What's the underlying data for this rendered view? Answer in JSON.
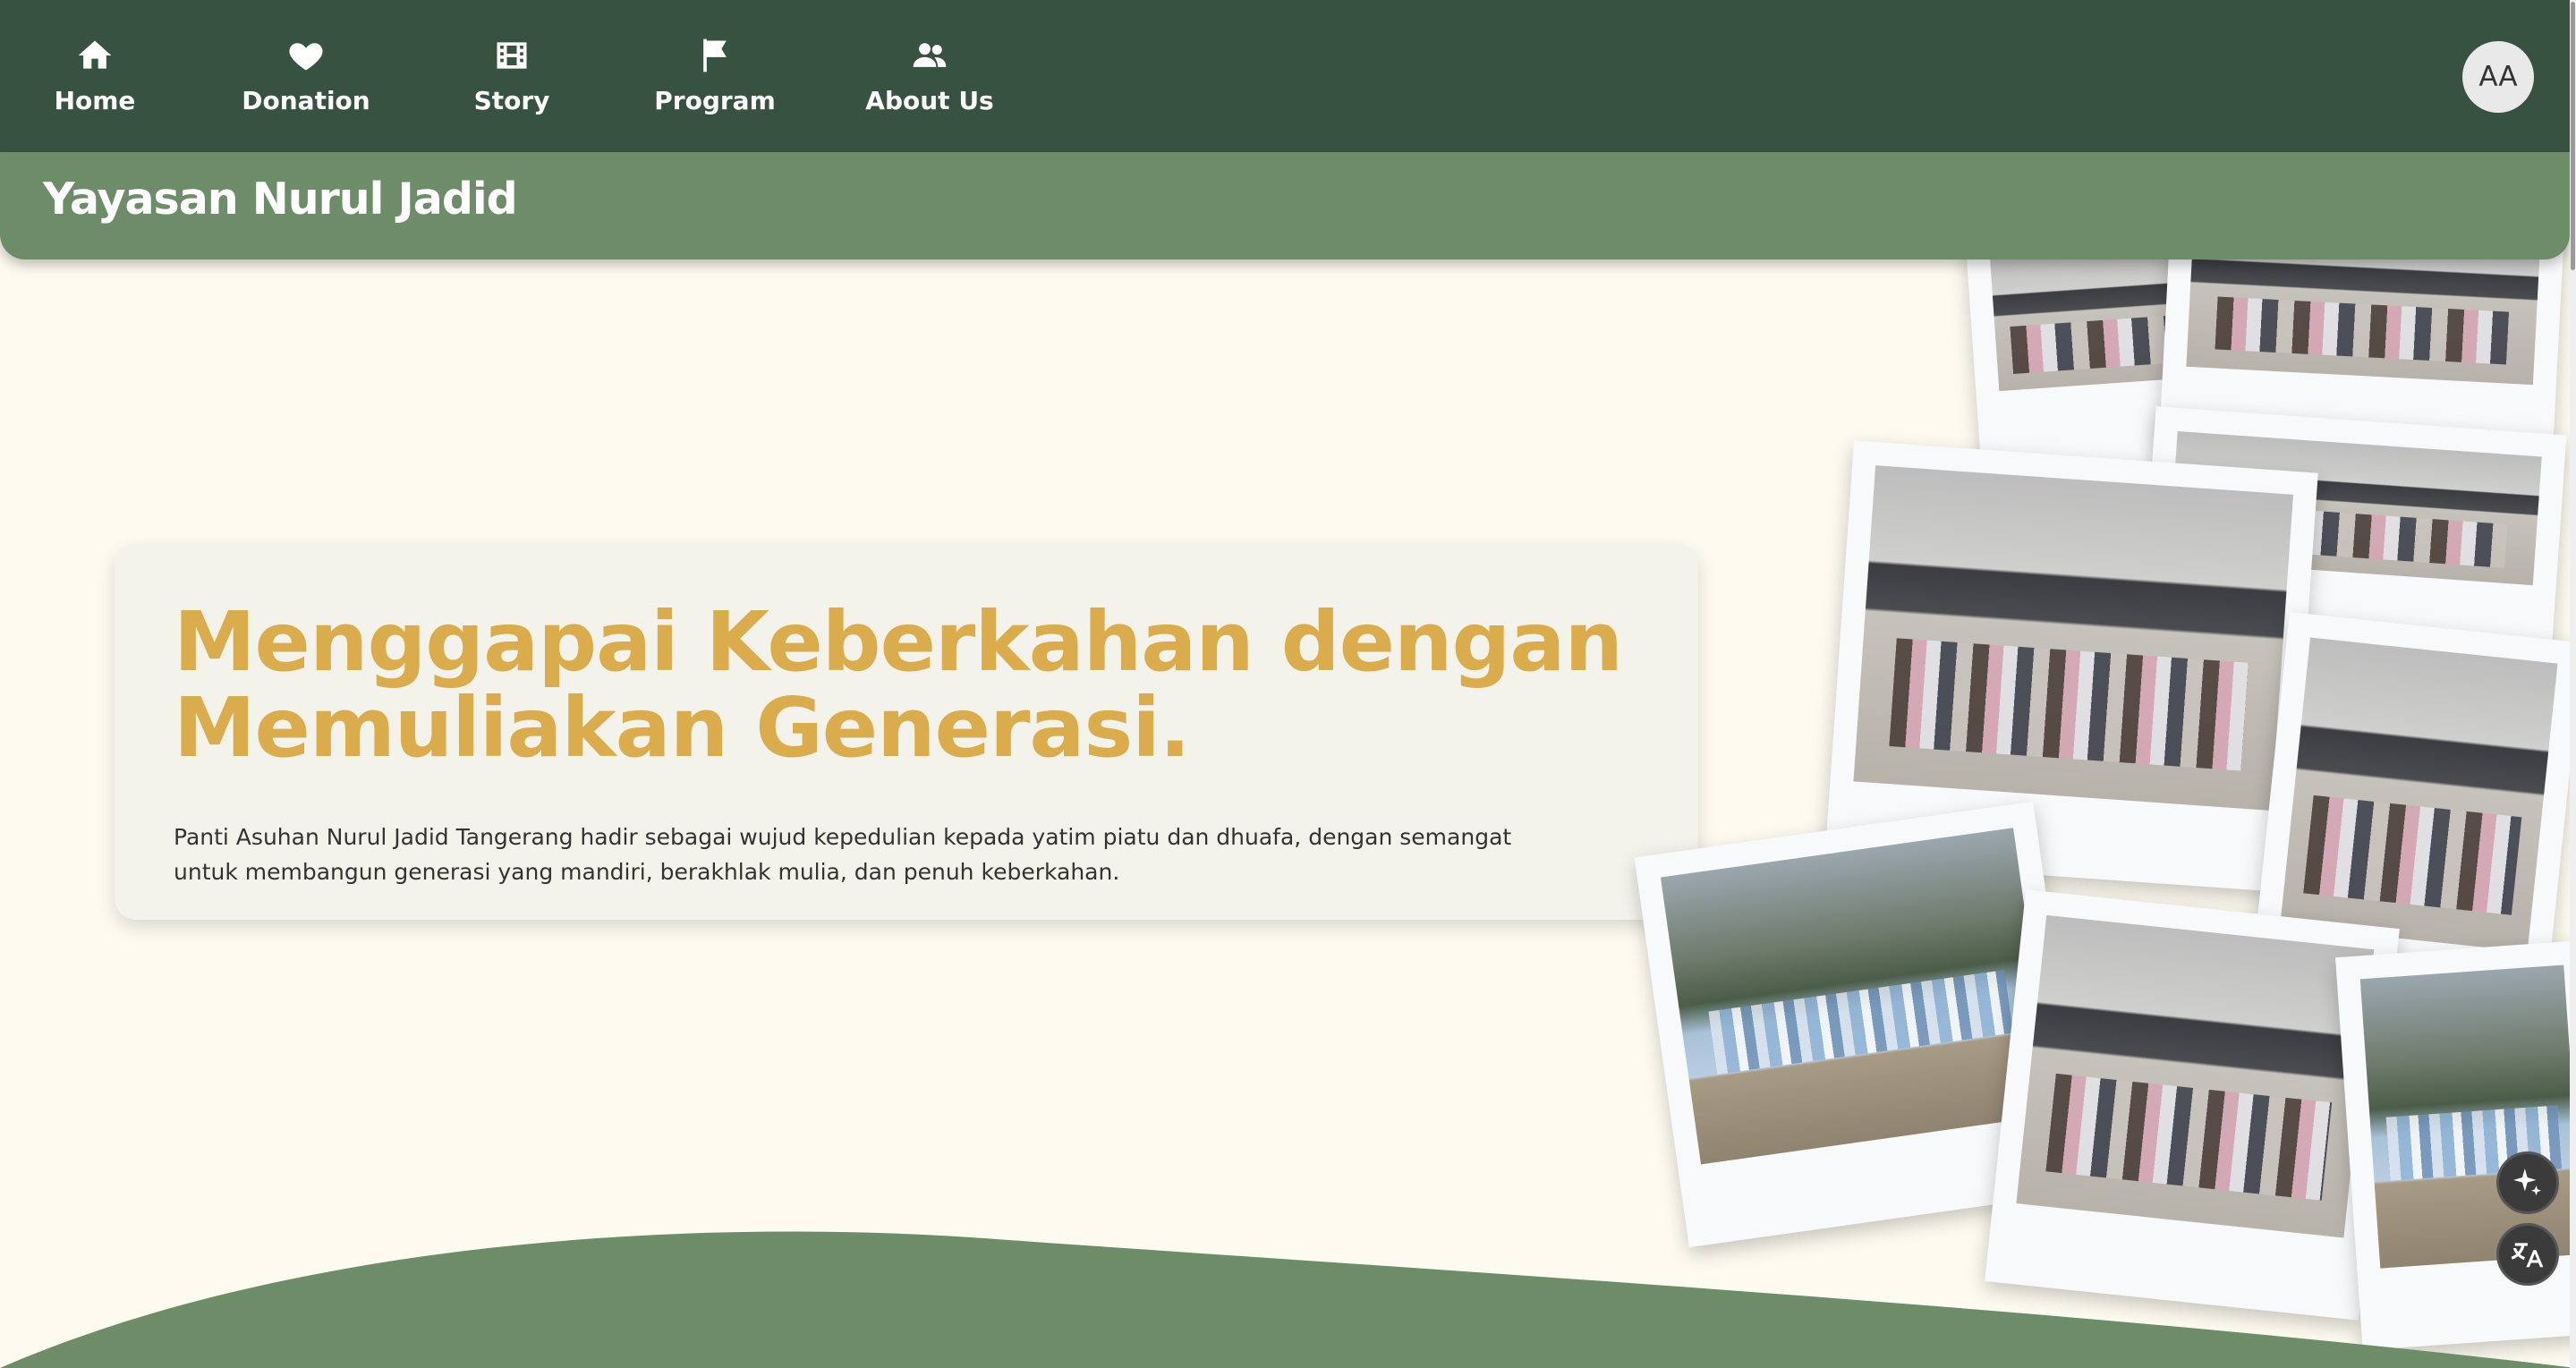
{
  "nav": {
    "items": [
      {
        "label": "Home",
        "icon": "home-icon"
      },
      {
        "label": "Donation",
        "icon": "heart-icon"
      },
      {
        "label": "Story",
        "icon": "film-icon"
      },
      {
        "label": "Program",
        "icon": "flag-icon"
      },
      {
        "label": "About Us",
        "icon": "users-icon"
      }
    ],
    "avatar_initials": "AA"
  },
  "header": {
    "brand": "Yayasan Nurul Jadid"
  },
  "hero": {
    "title": "Menggapai Keberkahan dengan Memuliakan Generasi.",
    "description": "Panti Asuhan Nurul Jadid Tangerang hadir sebagai wujud kepedulian kepada yatim piatu dan dhuafa, dengan semangat untuk membangun generasi yang mandiri, berakhlak mulia, dan penuh keberkahan."
  },
  "floating_buttons": [
    {
      "icon": "sparkle-icon"
    },
    {
      "icon": "translate-icon"
    }
  ],
  "colors": {
    "nav_bg": "#385241",
    "header_bg": "#6c8d68",
    "page_bg": "#fdfbef",
    "title_accent": "#dbac4c",
    "wave": "#6c8d68"
  }
}
